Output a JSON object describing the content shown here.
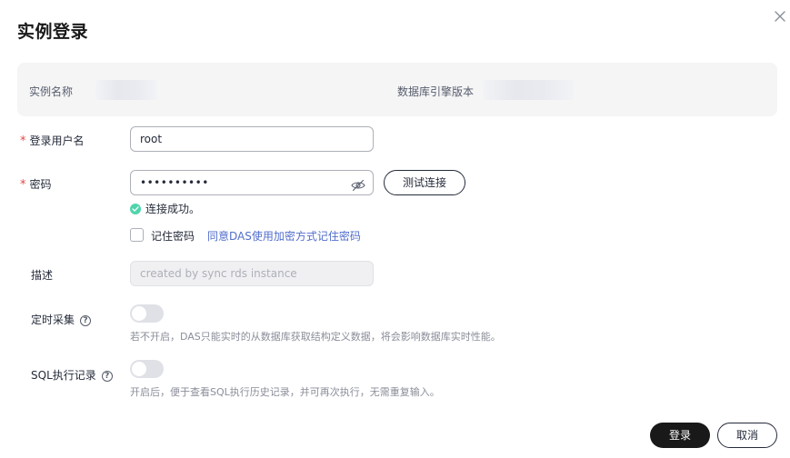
{
  "dialog": {
    "title": "实例登录",
    "close_icon": "close-icon"
  },
  "info": {
    "instance_name_label": "实例名称",
    "engine_version_label": "数据库引擎版本"
  },
  "form": {
    "username": {
      "label": "登录用户名",
      "value": "root",
      "required": true
    },
    "password": {
      "label": "密码",
      "masked_value": "••••••••••",
      "required": true,
      "icon": "eye-off-icon"
    },
    "test_button": "测试连接",
    "connect_status": "连接成功。",
    "remember": {
      "label": "记住密码",
      "link": "同意DAS使用加密方式记住密码",
      "checked": false
    },
    "description": {
      "label": "描述",
      "placeholder": "created by sync rds instance"
    },
    "scheduled_collection": {
      "label": "定时采集",
      "enabled": false,
      "hint": "若不开启，DAS只能实时的从数据库获取结构定义数据，将会影响数据库实时性能。"
    },
    "sql_record": {
      "label": "SQL执行记录",
      "enabled": false,
      "hint": "开启后，便于查看SQL执行历史记录，并可再次执行，无需重复输入。"
    }
  },
  "footer": {
    "login_button": "登录",
    "cancel_button": "取消"
  },
  "colors": {
    "required": "#e54545",
    "link": "#526ecc",
    "success": "#50d4ab",
    "primary_button": "#191919"
  }
}
